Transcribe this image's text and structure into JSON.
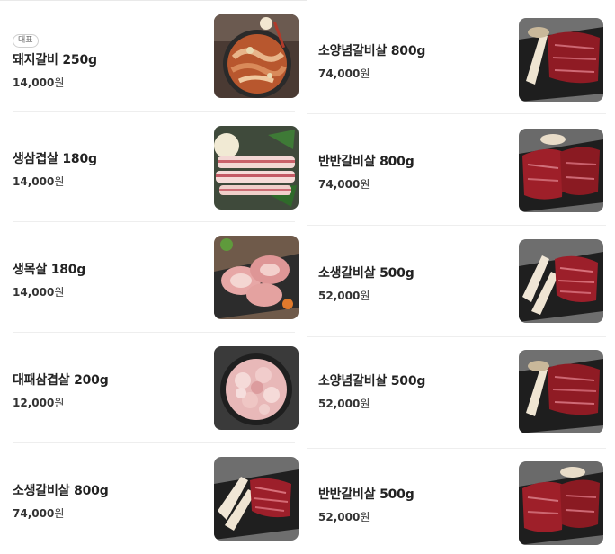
{
  "badge_label": "대표",
  "currency_unit": "원",
  "left_menu": [
    {
      "name": "돼지갈비 250g",
      "price": "14,000",
      "representative": true,
      "image": "pork-galbi-photo"
    },
    {
      "name": "생삼겹살 180g",
      "price": "14,000",
      "image": "pork-belly-photo"
    },
    {
      "name": "생목살 180g",
      "price": "14,000",
      "image": "pork-neck-photo"
    },
    {
      "name": "대패삼겹살 200g",
      "price": "12,000",
      "image": "thin-pork-belly-photo"
    },
    {
      "name": "소생갈비살 800g",
      "price": "74,000",
      "image": "beef-rib-meat-photo"
    }
  ],
  "right_menu": [
    {
      "name": "소양념갈비살 800g",
      "price": "74,000",
      "image": "marinated-beef-rib-photo"
    },
    {
      "name": "반반갈비살 800g",
      "price": "74,000",
      "image": "half-half-rib-photo"
    },
    {
      "name": "소생갈비살 500g",
      "price": "52,000",
      "image": "beef-rib-meat-photo"
    },
    {
      "name": "소양념갈비살 500g",
      "price": "52,000",
      "image": "marinated-beef-rib-photo"
    },
    {
      "name": "반반갈비살 500g",
      "price": "52,000",
      "image": "half-half-rib-photo"
    }
  ]
}
